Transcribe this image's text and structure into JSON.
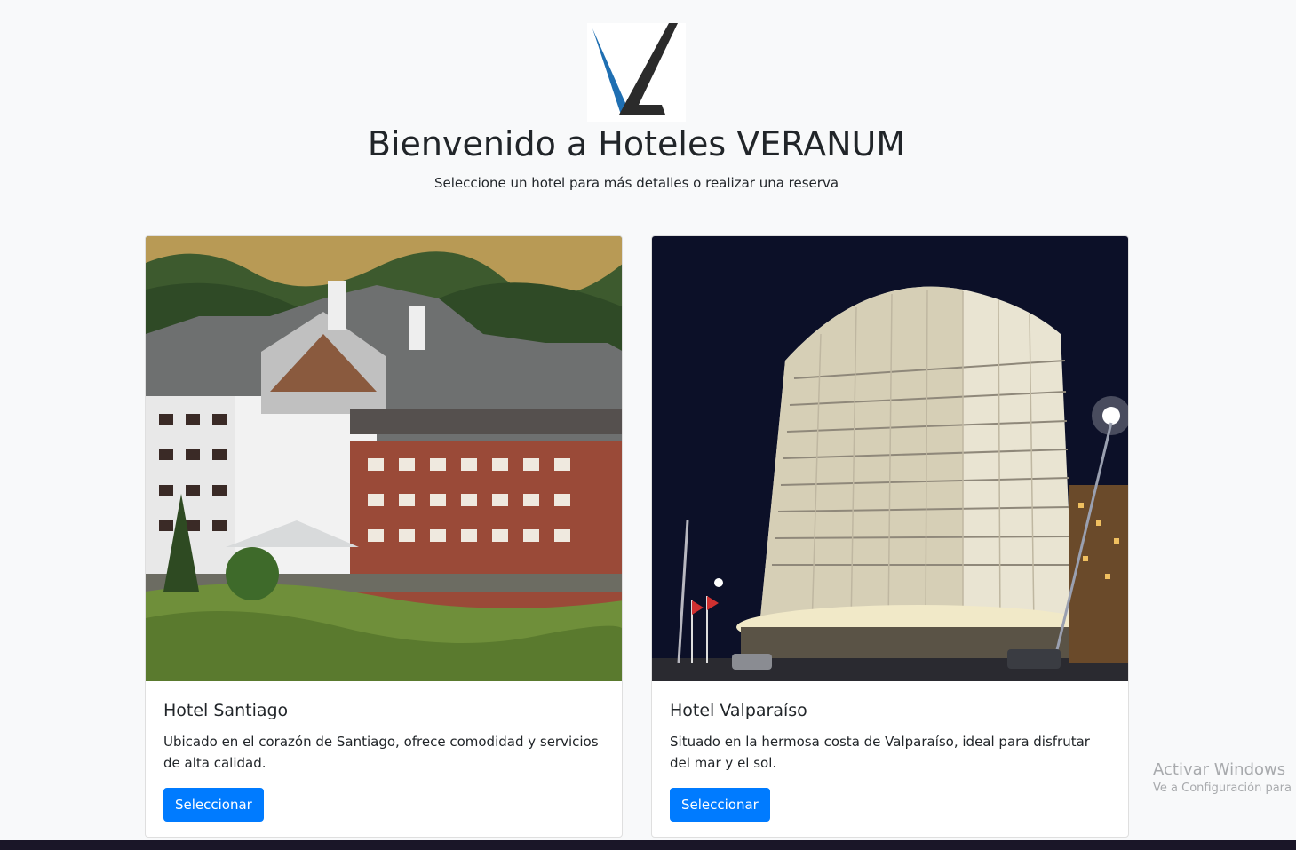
{
  "logo": {
    "icon": "veranum-logo",
    "colors": {
      "blue": "#1f6fb2",
      "dark": "#2b2b2b"
    }
  },
  "header": {
    "title": "Bienvenido a Hoteles VERANUM",
    "subtitle": "Seleccione un hotel para más detalles o realizar una reserva"
  },
  "hotels": [
    {
      "title": "Hotel Santiago",
      "description": "Ubicado en el corazón de Santiago, ofrece comodidad y servicios de alta calidad.",
      "button_label": "Seleccionar",
      "image": "mountain-hotel-photo"
    },
    {
      "title": "Hotel Valparaíso",
      "description": "Situado en la hermosa costa de Valparaíso, ideal para disfrutar del mar y el sol.",
      "button_label": "Seleccionar",
      "image": "night-tower-hotel-photo"
    }
  ],
  "watermark": {
    "line1": "Activar Windows",
    "line2": "Ve a Configuración para"
  },
  "accent": "#007bff"
}
